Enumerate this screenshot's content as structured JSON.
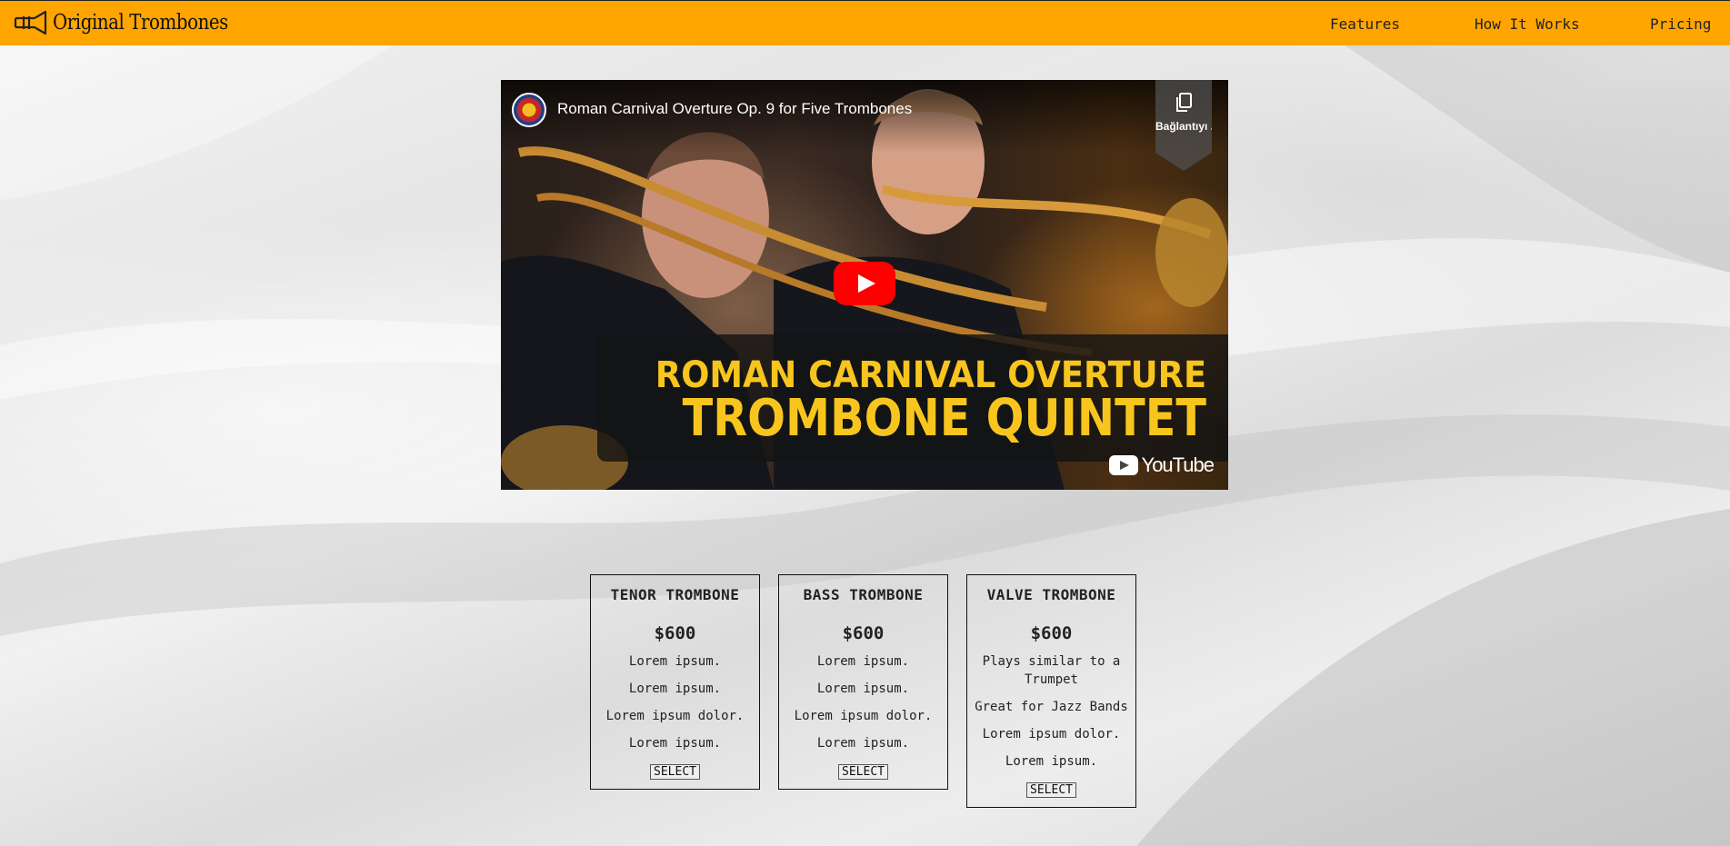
{
  "header": {
    "logo_icon": "trombone-icon",
    "brand": "Original Trombones",
    "nav": [
      {
        "label": "Features"
      },
      {
        "label": "How It Works"
      },
      {
        "label": "Pricing"
      }
    ]
  },
  "video": {
    "title": "Roman Carnival Overture Op. 9 for Five Trombones",
    "copy_link_label": "Bağlantıyı ...",
    "banner_line1": "ROMAN CARNIVAL OVERTURE",
    "banner_line2": "TROMBONE QUINTET",
    "platform": "YouTube",
    "play_icon": "play-icon"
  },
  "pricing": [
    {
      "name": "TENOR TROMBONE",
      "price": "$600",
      "features": [
        "Lorem ipsum.",
        "Lorem ipsum.",
        "Lorem ipsum dolor.",
        "Lorem ipsum."
      ],
      "button": "SELECT"
    },
    {
      "name": "BASS TROMBONE",
      "price": "$600",
      "features": [
        "Lorem ipsum.",
        "Lorem ipsum.",
        "Lorem ipsum dolor.",
        "Lorem ipsum."
      ],
      "button": "SELECT"
    },
    {
      "name": "VALVE TROMBONE",
      "price": "$600",
      "features": [
        "Plays similar to a Trumpet",
        "Great for Jazz Bands",
        "Lorem ipsum dolor.",
        "Lorem ipsum."
      ],
      "button": "SELECT"
    }
  ],
  "colors": {
    "header_bg": "#ffa500",
    "youtube_red": "#ff0000",
    "banner_text": "#f7c51e"
  }
}
